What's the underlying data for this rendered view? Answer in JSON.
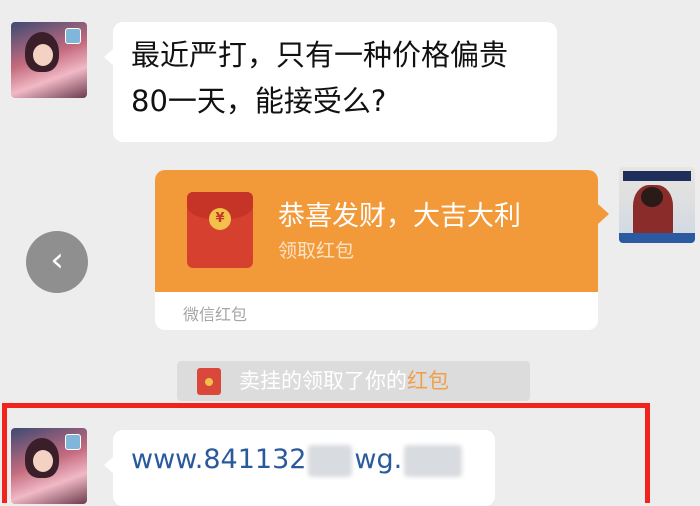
{
  "messages": {
    "first": {
      "line1": "最近严打，只有一种价格偏贵",
      "line2": "80一天，能接受么?"
    },
    "redpacket": {
      "title": "恭喜发财，大吉大利",
      "sub": "领取红包",
      "footer": "微信红包",
      "coin": "¥"
    },
    "system": {
      "prefix": "卖挂的领取了你的",
      "highlight": "红包"
    },
    "link": {
      "part1": "www.841132",
      "part2": "wg."
    }
  },
  "icons": {
    "back": "‹"
  },
  "colors": {
    "accent": "#f29a3a",
    "highlight_box": "#f0241c",
    "link": "#2a5a9c"
  }
}
